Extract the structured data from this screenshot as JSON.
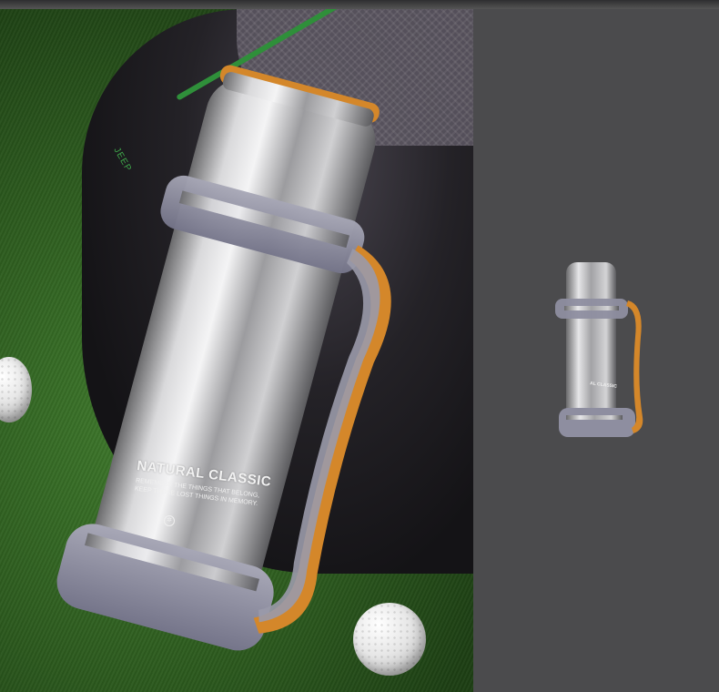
{
  "product": {
    "label_title": "NATURAL CLASSIC",
    "label_tagline": "REMEMBER THE THINGS THAT BELONG, KEEP THOSE LOST THINGS IN MEMORY.",
    "label_icon": "✲",
    "small_label_title": "AL CLASSIC"
  },
  "backpack": {
    "brand_text": "JEEP"
  },
  "colors": {
    "steel": "#c8c8ca",
    "sleeve": "#8e8ea0",
    "handle_accent": "#d4872a",
    "grass": "#2c5a1e",
    "backdrop": "#4b4b4d"
  }
}
